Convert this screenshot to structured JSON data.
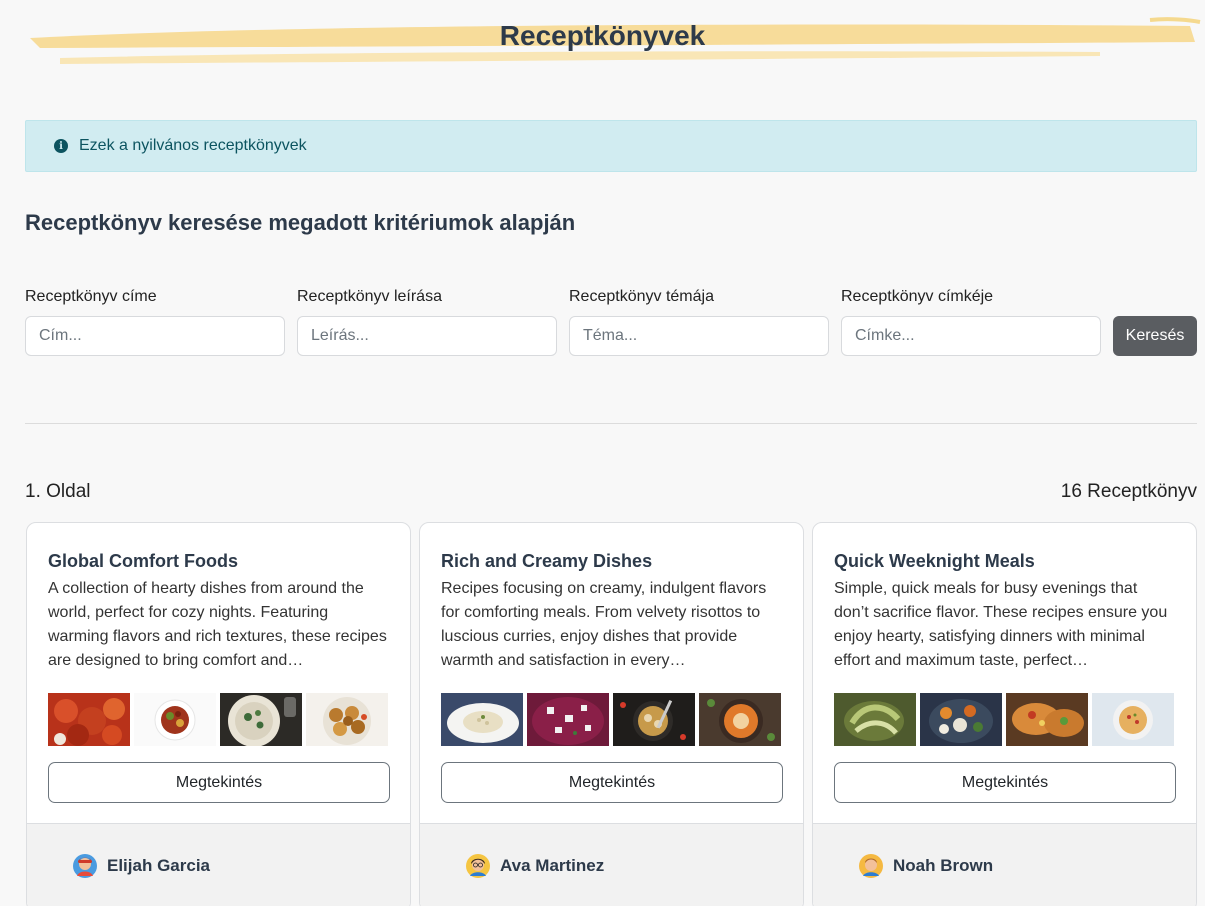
{
  "page": {
    "title": "Receptkönyvek"
  },
  "alert": {
    "icon": "info-circle-icon",
    "text": "Ezek a nyilvános receptkönyvek"
  },
  "search": {
    "heading": "Receptkönyv keresése megadott kritériumok alapján",
    "fields": [
      {
        "label": "Receptkönyv címe",
        "placeholder": "Cím..."
      },
      {
        "label": "Receptkönyv leírása",
        "placeholder": "Leírás..."
      },
      {
        "label": "Receptkönyv témája",
        "placeholder": "Téma..."
      },
      {
        "label": "Receptkönyv címkéje",
        "placeholder": "Címke..."
      }
    ],
    "button_label": "Keresés"
  },
  "results": {
    "page_label": "1. Oldal",
    "count_label": "16 Receptkönyv"
  },
  "cards": [
    {
      "title": "Global Comfort Foods",
      "description": "A collection of hearty dishes from around the world, perfect for cozy nights. Featuring warming flavors and rich textures, these recipes are designed to bring comfort and…",
      "button_label": "Megtekintés",
      "author": "Elijah Garcia"
    },
    {
      "title": "Rich and Creamy Dishes",
      "description": "Recipes focusing on creamy, indulgent flavors for comforting meals. From velvety risottos to luscious curries, enjoy dishes that provide warmth and satisfaction in every…",
      "button_label": "Megtekintés",
      "author": "Ava Martinez"
    },
    {
      "title": "Quick Weeknight Meals",
      "description": "Simple, quick meals for busy evenings that don’t sacrifice flavor. These recipes ensure you enjoy hearty, satisfying dinners with minimal effort and maximum taste, perfect…",
      "button_label": "Megtekintés",
      "author": "Noah Brown"
    }
  ],
  "colors": {
    "accent_band": "#f7dc9a",
    "alert_bg": "#d1ecf1",
    "alert_text": "#0c5460",
    "button_dark": "#5a5d61"
  }
}
